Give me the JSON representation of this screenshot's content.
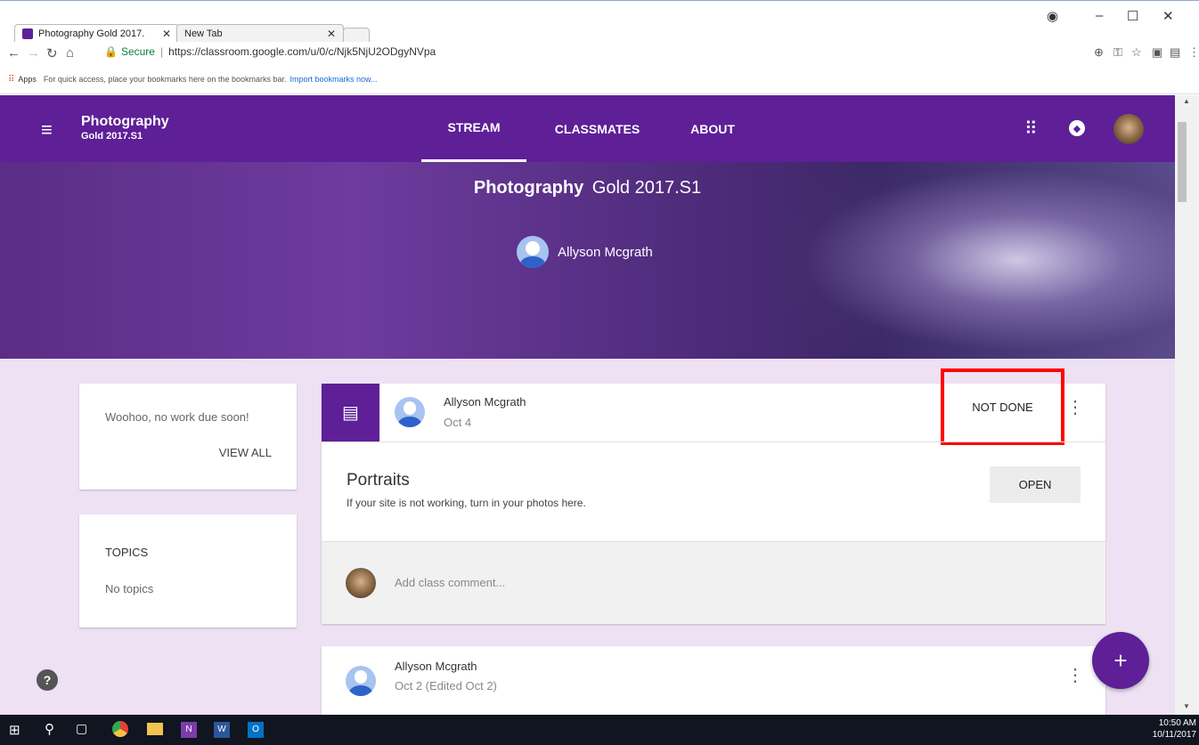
{
  "browser": {
    "tabs": [
      {
        "title": "Photography Gold 2017.",
        "active": true
      },
      {
        "title": "New Tab",
        "active": false
      }
    ],
    "secure_label": "Secure",
    "url": "https://classroom.google.com/u/0/c/Njk5NjU2ODgyNVpa",
    "bookmarks": {
      "apps": "Apps",
      "prompt": "For quick access, place your bookmarks here on the bookmarks bar.",
      "import_link": "Import bookmarks now..."
    }
  },
  "appbar": {
    "class_name": "Photography",
    "section": "Gold 2017.S1",
    "tabs": [
      "STREAM",
      "CLASSMATES",
      "ABOUT"
    ],
    "active_tab": "STREAM"
  },
  "banner": {
    "title": "Photography",
    "section": "Gold 2017.S1",
    "teacher": "Allyson Mcgrath"
  },
  "upcoming": {
    "message": "Woohoo, no work due soon!",
    "view_all": "VIEW ALL"
  },
  "topics": {
    "heading": "TOPICS",
    "empty": "No topics"
  },
  "post1": {
    "author": "Allyson Mcgrath",
    "date": "Oct 4",
    "status": "NOT DONE",
    "title": "Portraits",
    "description": "If your site is not working, turn in your photos here.",
    "open": "OPEN",
    "comment_placeholder": "Add class comment..."
  },
  "post2": {
    "author": "Allyson Mcgrath",
    "date": "Oct 2 (Edited Oct 2)"
  },
  "fab": "+",
  "help": "?",
  "taskbar": {
    "time": "10:50 AM",
    "date": "10/11/2017"
  },
  "colors": {
    "accent": "#5e1f97",
    "highlight": "#ff0000",
    "background": "#ede1f3"
  }
}
